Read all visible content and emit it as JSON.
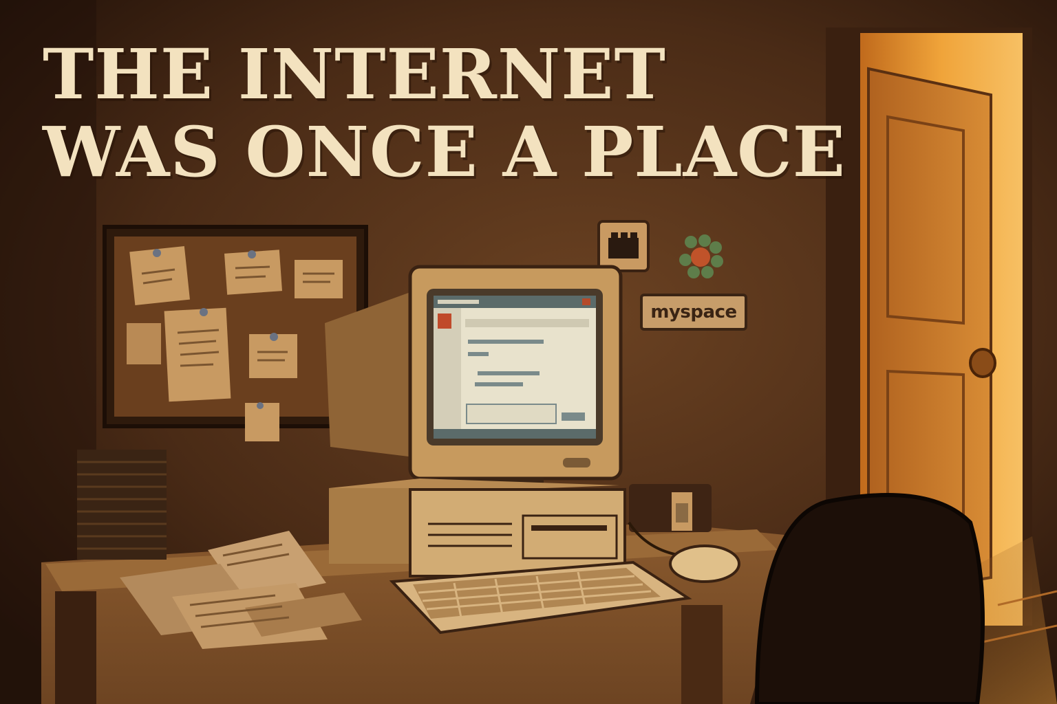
{
  "headline": {
    "line1": "THE INTERNET",
    "line2": "WAS ONCE A PLACE"
  },
  "wall_sticker": {
    "label": "myspace"
  },
  "icons": [
    "film-sticker-icon",
    "flower-sticker-icon",
    "crt-monitor-icon",
    "keyboard-icon",
    "mouse-icon",
    "office-chair-icon",
    "door-icon"
  ],
  "colors": {
    "wall": "#4a2c18",
    "headline": "#f3e2bf",
    "door_light": "#f0a43a",
    "screen": "#e8e2cc"
  }
}
